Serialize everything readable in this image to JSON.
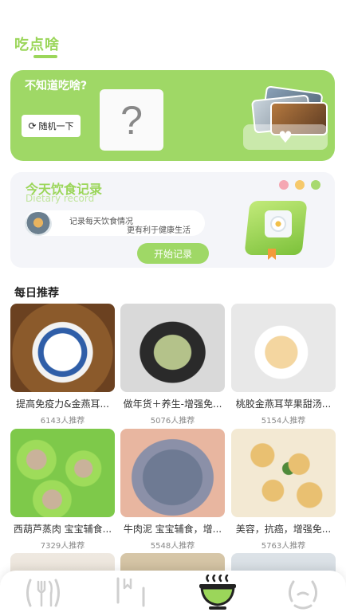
{
  "header": {
    "title": "吃点啥"
  },
  "random_card": {
    "title": "不知道吃啥?",
    "button_label": "随机一下",
    "question_mark": "?"
  },
  "diary_card": {
    "title": "今天饮食记录",
    "subtitle": "Dietary record",
    "bubble_line1": "记录每天饮食情况",
    "bubble_line2": "更有利于健康生活",
    "button_label": "开始记录"
  },
  "recommend": {
    "title": "每日推荐",
    "items": [
      {
        "name": "提高免疫力&金燕耳...",
        "count": "6143人推荐"
      },
      {
        "name": "做年货＋养生-增强免...",
        "count": "5076人推荐"
      },
      {
        "name": "桃胶金燕耳苹果甜汤...",
        "count": "5154人推荐"
      },
      {
        "name": "西葫芦蒸肉 宝宝辅食...",
        "count": "7329人推荐"
      },
      {
        "name": "牛肉泥 宝宝辅食，增...",
        "count": "5548人推荐"
      },
      {
        "name": "美容，抗癌，增强免...",
        "count": "5763人推荐"
      }
    ]
  },
  "tabbar": {
    "tabs": [
      {
        "icon": "fork-knife-icon"
      },
      {
        "icon": "book-bookmark-icon"
      },
      {
        "icon": "bowl-icon",
        "active": true
      },
      {
        "icon": "smile-face-icon"
      }
    ],
    "active_color": "#9bd65a",
    "inactive_color": "#cccccc"
  }
}
